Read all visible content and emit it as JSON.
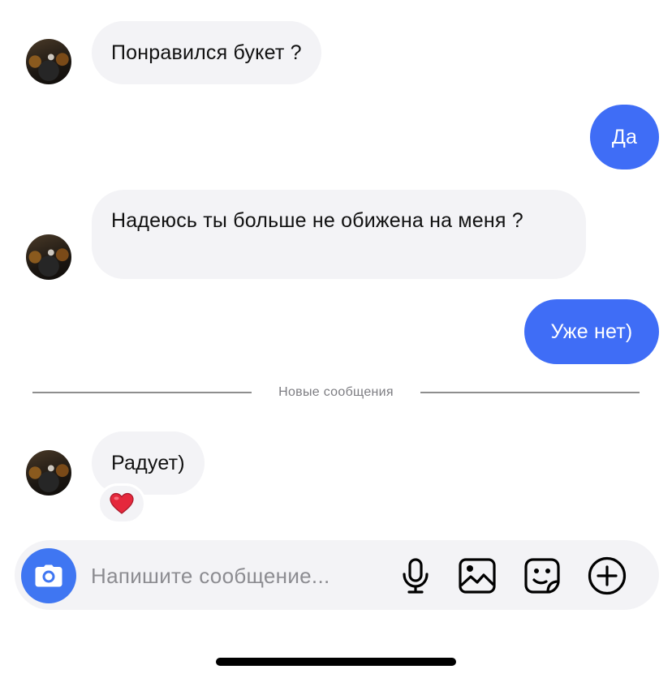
{
  "chat": {
    "messages": [
      {
        "direction": "incoming",
        "text": "Понравился букет ?"
      },
      {
        "direction": "outgoing",
        "text": "Да"
      },
      {
        "direction": "incoming",
        "text": "Надеюсь ты больше не обижена на меня ?"
      },
      {
        "direction": "outgoing",
        "text": "Уже нет)"
      },
      {
        "direction": "incoming",
        "text": "Радует)",
        "reaction": "❤️"
      }
    ],
    "new_messages_divider": "Новые сообщения"
  },
  "composer": {
    "placeholder": "Напишите сообщение...",
    "value": ""
  },
  "icons": {
    "camera": "camera-icon",
    "mic": "microphone-icon",
    "gallery": "image-icon",
    "sticker": "sticker-icon",
    "plus": "plus-circle-icon"
  },
  "colors": {
    "outgoing_bubble": "#3f6df6",
    "incoming_bubble": "#f3f3f6",
    "camera_button": "#3f76f2",
    "divider_text": "#7d7d82"
  }
}
